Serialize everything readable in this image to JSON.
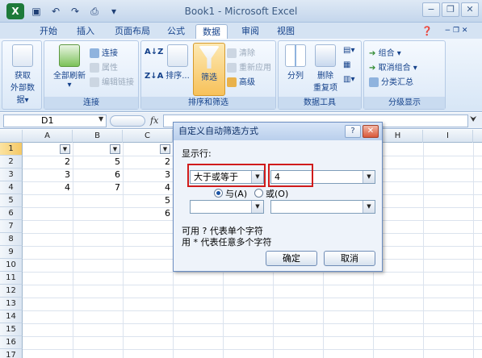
{
  "title": "Book1 - Microsoft Excel",
  "tabs": [
    "开始",
    "插入",
    "页面布局",
    "公式",
    "数据",
    "审阅",
    "视图"
  ],
  "active_tab": "数据",
  "ribbon": {
    "get_data": {
      "label1": "获取",
      "label2": "外部数据"
    },
    "connections": {
      "refresh_all": "全部刷新",
      "connections": "连接",
      "properties": "属性",
      "edit_links": "编辑链接",
      "group_label": "连接"
    },
    "sort_filter": {
      "sort": "排序...",
      "filter": "筛选",
      "clear": "清除",
      "reapply": "重新应用",
      "advanced": "高级",
      "group_label": "排序和筛选"
    },
    "data_tools": {
      "text_to_columns": "分列",
      "remove_dup1": "删除",
      "remove_dup2": "重复项",
      "group_label": "数据工具"
    },
    "outline": {
      "group": "组合",
      "ungroup": "取消组合",
      "subtotal": "分类汇总",
      "group_label": "分级显示"
    }
  },
  "name_box": "D1",
  "fx": "fx",
  "columns": [
    "A",
    "B",
    "C",
    "D",
    "E",
    "F",
    "G",
    "H",
    "I"
  ],
  "rows": [
    "1",
    "2",
    "3",
    "4",
    "5",
    "6",
    "7",
    "8",
    "9",
    "10",
    "11",
    "12",
    "13",
    "14",
    "15",
    "16",
    "17"
  ],
  "cells": {
    "A": [
      "2",
      "3",
      "4"
    ],
    "B": [
      "5",
      "6",
      "7"
    ],
    "C": [
      "2",
      "3",
      "4",
      "5",
      "6"
    ]
  },
  "dialog": {
    "title": "自定义自动筛选方式",
    "show_rows": "显示行:",
    "operator1": "大于或等于",
    "value1": "4",
    "and_label": "与(A)",
    "or_label": "或(O)",
    "hint1": "可用 ? 代表单个字符",
    "hint2": "用 * 代表任意多个字符",
    "ok": "确定",
    "cancel": "取消"
  }
}
